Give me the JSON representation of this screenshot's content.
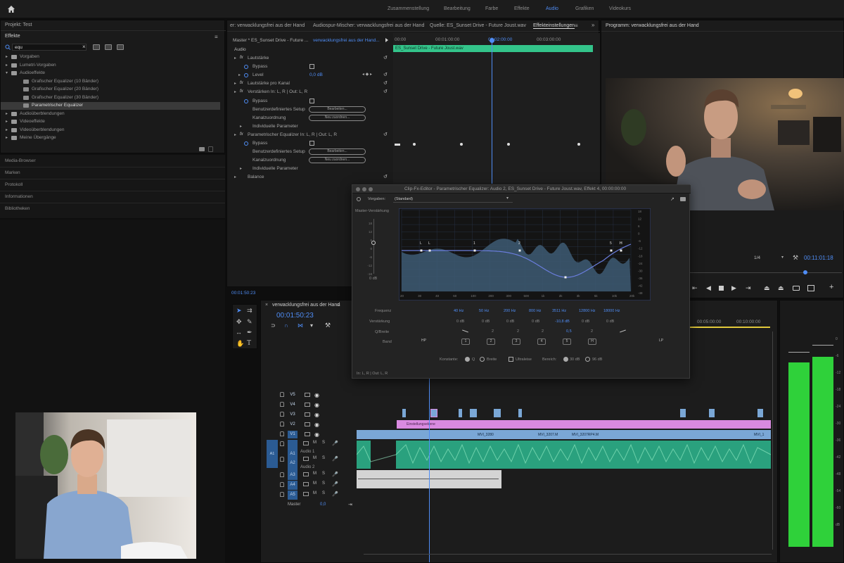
{
  "topbar": {
    "workspaces": [
      "Zusammenstellung",
      "Bearbeitung",
      "Farbe",
      "Effekte",
      "Audio",
      "Grafiken",
      "Videokurs"
    ],
    "active": "Audio"
  },
  "project": {
    "title": "Projekt: Test"
  },
  "effects": {
    "tab": "Effekte",
    "search_value": "equ",
    "tree": [
      {
        "label": "Vorgaben",
        "indent": 0
      },
      {
        "label": "Lumetri-Vorgaben",
        "indent": 0
      },
      {
        "label": "Audioeffekte",
        "indent": 0
      },
      {
        "label": "Grafischer Equalizer (10 Bänder)",
        "indent": 1
      },
      {
        "label": "Grafischer Equalizer (20 Bänder)",
        "indent": 1
      },
      {
        "label": "Grafischer Equalizer (30 Bänder)",
        "indent": 1
      },
      {
        "label": "Parametrischer Equalizer",
        "indent": 1,
        "selected": true
      },
      {
        "label": "Audioüberblendungen",
        "indent": 0
      },
      {
        "label": "Videoeffekte",
        "indent": 0
      },
      {
        "label": "Videoüberblendungen",
        "indent": 0
      },
      {
        "label": "Meine Übergänge",
        "indent": 0
      }
    ]
  },
  "side_panels": [
    "Media-Browser",
    "Marken",
    "Protokoll",
    "Informationen",
    "Bibliotheken"
  ],
  "source_tabs": [
    "er: verwacklungsfrei aus der Hand",
    "Audiospur-Mischer: verwacklungsfrei aus der Hand",
    "Quelle: ES_Sunset Drive - Future Joust.wav",
    "Effekteinstellungen"
  ],
  "program_tab": "Programm: verwacklungsfrei aus der Hand",
  "effect_controls": {
    "master": "Master * ES_Sunset Drive - Future ...",
    "sequence": "verwacklungsfrei aus der Hand...",
    "section": "Audio",
    "clip_label": "ES_Sunset Drive - Future Joust.wav",
    "ruler": [
      "00:00",
      "00:01:00:00",
      "00:02:00:00",
      "00:03:00:00"
    ],
    "rows": [
      {
        "label": "Lautstärke",
        "level": 1,
        "fx": true
      },
      {
        "label": "Bypass",
        "level": 2,
        "checkbox": true
      },
      {
        "label": "Level",
        "level": 2,
        "value": "0,0 dB"
      },
      {
        "label": "Lautstärke pro Kanal",
        "level": 1,
        "fx": true
      },
      {
        "label": "Verstärken In: L, R | Out: L, R",
        "level": 1,
        "fx": true
      },
      {
        "label": "Bypass",
        "level": 2,
        "checkbox": true
      },
      {
        "label": "Benutzerdefiniertes Setup",
        "level": 2,
        "button": "Bearbeiten..."
      },
      {
        "label": "Kanalzuordnung",
        "level": 2,
        "button": "Neu zuordnen..."
      },
      {
        "label": "Individuelle Parameter",
        "level": 2
      },
      {
        "label": "Parametrischer Equalizer In: L, R | Out: L, R",
        "level": 1,
        "fx": true
      },
      {
        "label": "Bypass",
        "level": 2,
        "checkbox": true
      },
      {
        "label": "Benutzerdefiniertes Setup",
        "level": 2,
        "button": "Bearbeiten..."
      },
      {
        "label": "Kanalzuordnung",
        "level": 2,
        "button": "Neu zuordnen..."
      },
      {
        "label": "Individuelle Parameter",
        "level": 2
      },
      {
        "label": "Balance",
        "level": 1
      }
    ],
    "timecode": "00:01:50:23"
  },
  "program": {
    "zoom": "1/4",
    "timecode": "00:11:01:18"
  },
  "timeline": {
    "tab": "verwacklungsfrei aus der Hand",
    "timecode": "00:01:50:23",
    "ruler": [
      "00:05:00:00",
      "00:10:00:00"
    ],
    "video_tracks": [
      "V5",
      "V4",
      "V3",
      "V2",
      "V1"
    ],
    "audio_tracks": [
      {
        "id": "A1",
        "name": "Audio 1"
      },
      {
        "id": "A2",
        "name": "Audio 2"
      },
      {
        "id": "A3",
        "name": ""
      },
      {
        "id": "A4",
        "name": ""
      },
      {
        "id": "A5",
        "name": ""
      }
    ],
    "master_label": "Master",
    "master_value": "0,0",
    "clip_v2": "Einstellungsebene",
    "clip_v1_a": "MVI_3280",
    "clip_v1_b": "MVI_3207.M",
    "clip_v1_c": "MVI_3207RP4.M",
    "clip_v1_d": "MVI_1"
  },
  "eq_dialog": {
    "title": "Clip-Fx-Editor - Parametrischer Equalizer: Audio 2, ES_Sunset Drive - Future Joust.wav, Effekt 4, 00:00:00:00",
    "preset_label": "Vorgaben:",
    "preset_value": "(Standard)",
    "master_gain": "Master-Verstärkung",
    "db_zero": "0 dB",
    "db_scale": [
      "18",
      "12",
      "6",
      "0",
      "-6",
      "-12",
      "-18",
      "-24",
      "-30",
      "-36",
      "-42",
      "-48"
    ],
    "freq_scale": [
      "20",
      "30",
      "40",
      "60",
      "100",
      "200",
      "300",
      "500",
      "1k",
      "2k",
      "3k",
      "5k",
      "10k",
      "20k"
    ],
    "rows": [
      "Frequenz",
      "Verstärkung",
      "Q/Breite",
      "Band"
    ],
    "frequencies": [
      "40 Hz",
      "50 Hz",
      "200 Hz",
      "800 Hz",
      "3511 Hz",
      "12800 Hz",
      "18000 Hz"
    ],
    "gains": [
      "0 dB",
      "0 dB",
      "0 dB",
      "0 dB",
      "-10,8 dB",
      "0 dB",
      "0 dB"
    ],
    "q_values": [
      "2",
      "2",
      "2",
      "0,5",
      "2"
    ],
    "bands": [
      "HP",
      "1",
      "2",
      "3",
      "4",
      "5",
      "H",
      "LP"
    ],
    "constant_label": "Konstante:",
    "constant_opts": [
      "Q",
      "Breite"
    ],
    "ultraquiet": "Ultraleise",
    "range_label": "Bereich:",
    "range_opts": [
      "30 dB",
      "96 dB"
    ],
    "io": "In: L, R | Out: L, R",
    "node_labels": [
      "L",
      "1",
      "2",
      "3",
      "5",
      "H"
    ]
  },
  "meter_scale": [
    "0",
    "-6",
    "-12",
    "-18",
    "-24",
    "-30",
    "-36",
    "-42",
    "-48",
    "-54",
    "-60",
    "dB"
  ],
  "colors": {
    "accent": "#4f8df5",
    "audio": "#2aa17e",
    "video_clip": "#7aa7d6",
    "adjust": "#d98ae0",
    "meter": "#2fd13a"
  }
}
